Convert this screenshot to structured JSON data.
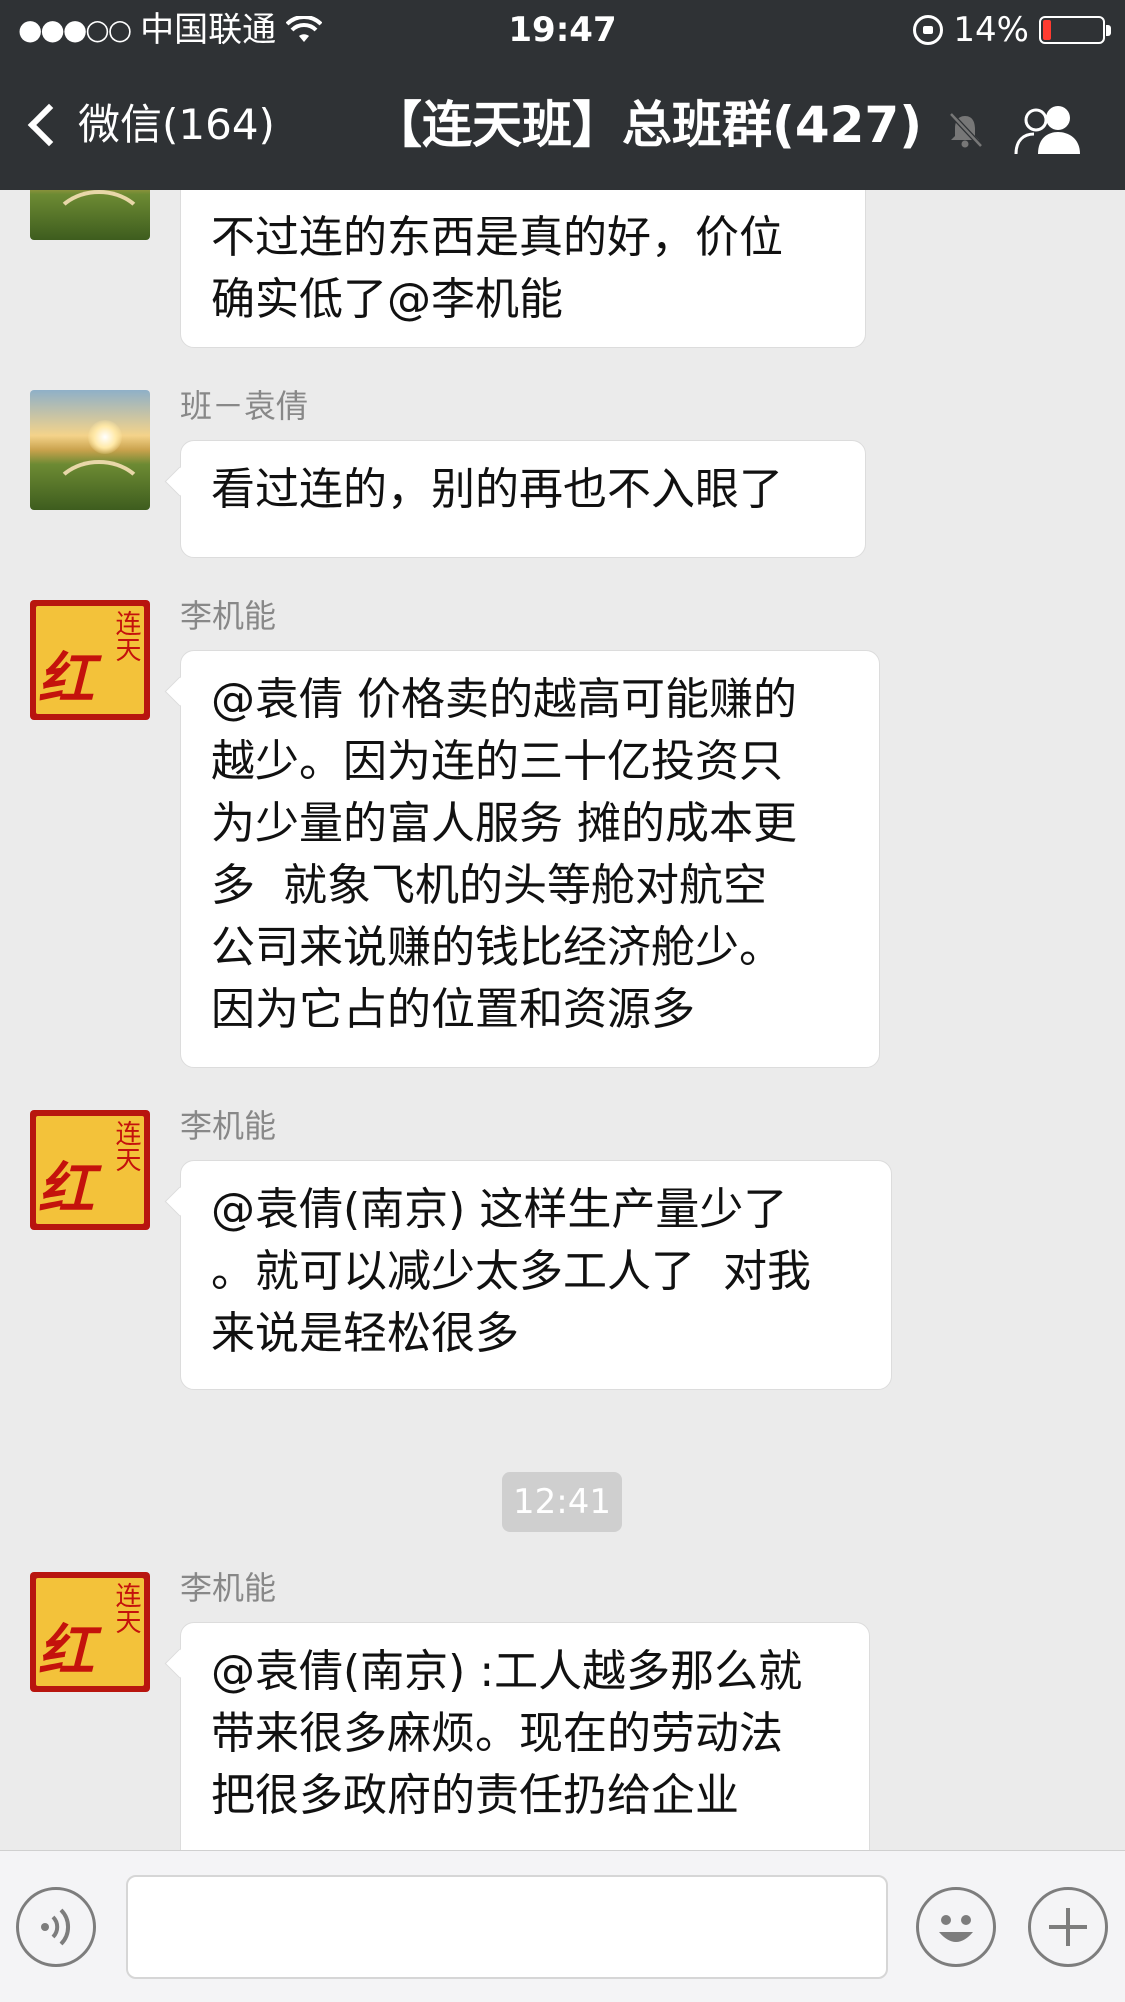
{
  "status_bar": {
    "signal_dots": "●●●○○",
    "carrier": "中国联通",
    "time": "19:47",
    "battery_percent": "14%",
    "battery_level": 0.14
  },
  "header": {
    "back_label": "微信(164)",
    "title": "【连天班】总班群(427)",
    "icons": [
      "wifi-icon",
      "back-chevron-icon",
      "mute-bell-icon",
      "group-members-icon",
      "rotation-lock-icon"
    ]
  },
  "messages": [
    {
      "sender": "",
      "avatar": "landscape",
      "lines": [
        "不过连的东西是真的好，价位",
        "确实低了@李机能"
      ]
    },
    {
      "sender": "班－袁倩",
      "avatar": "landscape",
      "lines": [
        "看过连的，别的再也不入眼了"
      ]
    },
    {
      "sender": "李机能",
      "avatar": "red-seal",
      "lines": [
        "@袁倩 价格卖的越高可能赚的",
        "越少。因为连的三十亿投资只",
        "为少量的富人服务 摊的成本更",
        "多  就象飞机的头等舱对航空",
        "公司来说赚的钱比经济舱少。",
        "因为它占的位置和资源多"
      ]
    },
    {
      "sender": "李机能",
      "avatar": "red-seal",
      "lines": [
        "@袁倩(南京) 这样生产量少了",
        "。就可以减少太多工人了  对我",
        "来说是轻松很多"
      ]
    },
    {
      "sender": "李机能",
      "avatar": "red-seal",
      "lines": [
        "@袁倩(南京) :工人越多那么就",
        "带来很多麻烦。现在的劳动法",
        "把很多政府的责任扔给企业"
      ]
    }
  ],
  "timestamp": "12:41",
  "avatar_seal": {
    "big": "红",
    "small": "连天"
  },
  "input_bar": {
    "voice_button": "voice-icon",
    "emoji_button": "emoji-icon",
    "plus_button": "plus-icon",
    "text_value": ""
  }
}
